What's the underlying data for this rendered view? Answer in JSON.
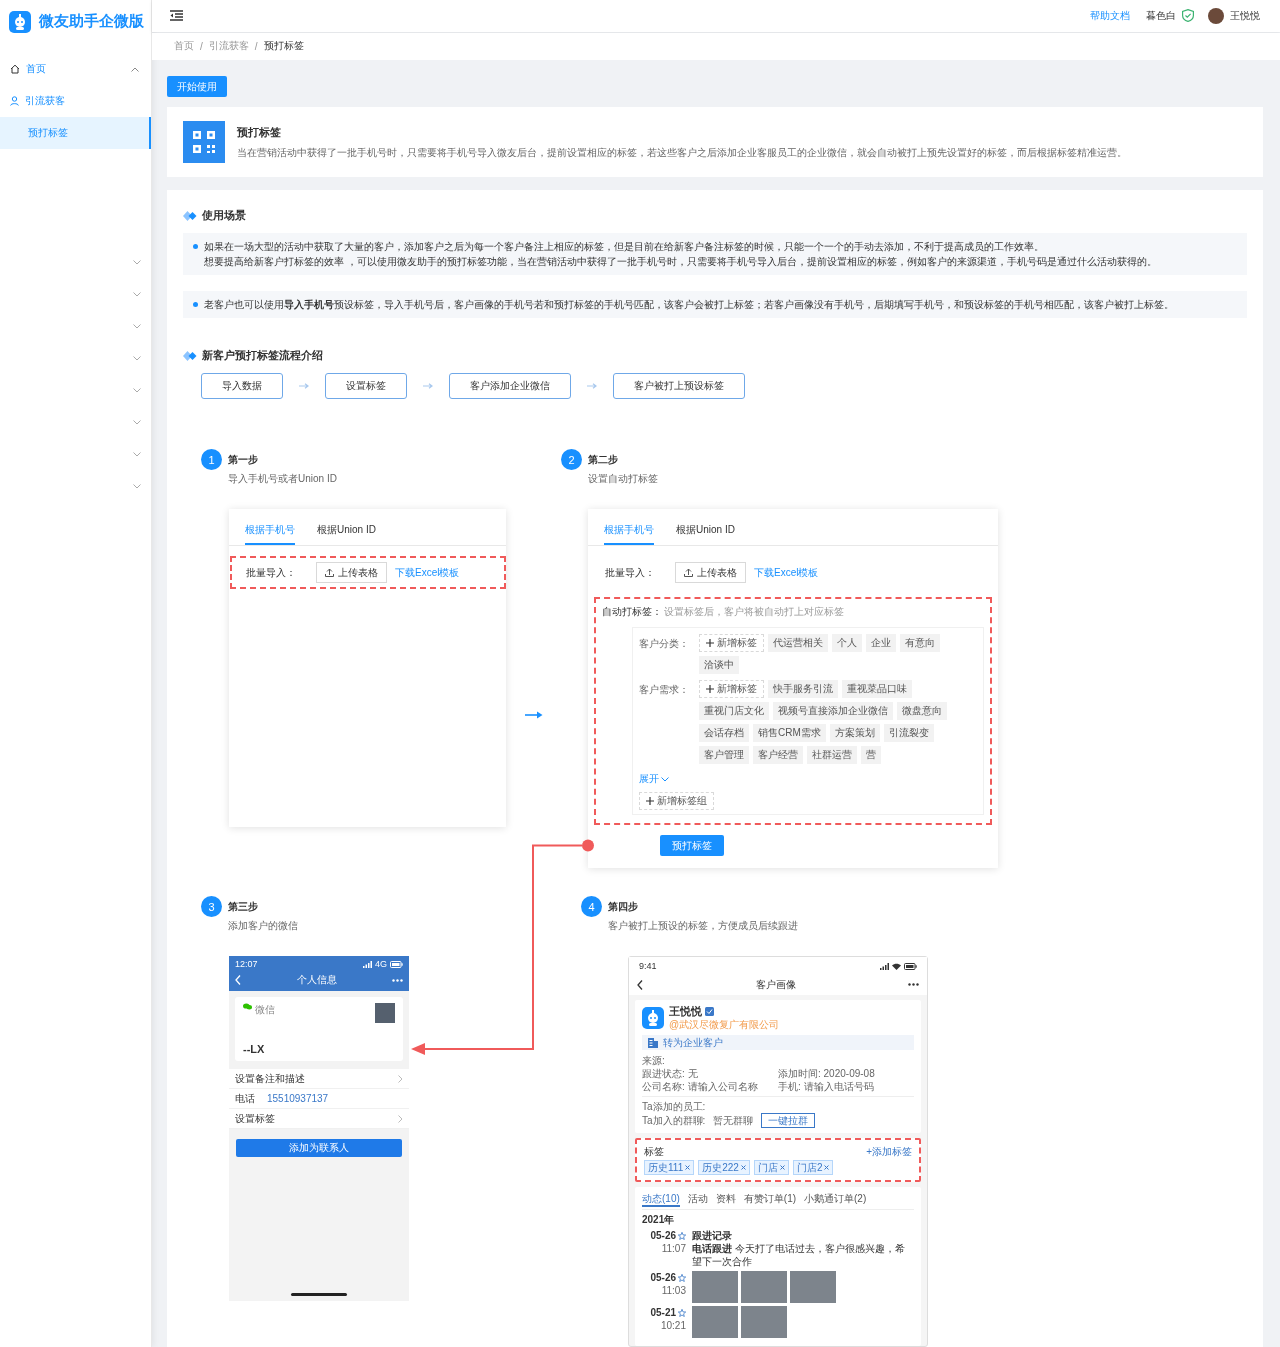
{
  "sidebar": {
    "brand": "微友助手企微版",
    "menu": [
      {
        "label": "首页",
        "expanded": true,
        "children": [
          {
            "label": "引流获客",
            "selected": false,
            "children": [
              {
                "label": "预打标签",
                "selected": true
              }
            ]
          }
        ]
      }
    ],
    "menu_groups": [
      {
        "expanded": false
      },
      {
        "expanded": false
      },
      {
        "expanded": false
      },
      {
        "expanded": false
      },
      {
        "expanded": false
      },
      {
        "expanded": false
      },
      {
        "expanded": false
      },
      {
        "expanded": false
      }
    ]
  },
  "header": {
    "help_link": "帮助文档",
    "theme": "暮色白",
    "user": "王悦悦"
  },
  "breadcrumb": {
    "separator": "/",
    "items": [
      "首页",
      "引流获客",
      "预打标签"
    ]
  },
  "start_button": "开始使用",
  "intro": {
    "title": "预打标签",
    "description": "当在营销活动中获得了一批手机号时，只需要将手机号导入微友后台，提前设置相应的标签，若这些客户之后添加企业客服员工的企业微信，就会自动被打上预先设置好的标签，而后根据标签精准运营。"
  },
  "scenarios": {
    "title": "使用场景",
    "notes": [
      {
        "lines": [
          "如果在一场大型的活动中获取了大量的客户，添加客户之后为每一个客户备注上相应的标签，但是目前在给新客户备注标签的时候，只能一个一个的手动去添加，不利于提高成员的工作效率。",
          "想要提高给新客户打标签的效率 ，可以使用微友助手的预打标签功能，当在营销活动中获得了一批手机号时，只需要将手机号导入后台，提前设置相应的标签，例如客户的来源渠道，手机号码是通过什么活动获得的。"
        ]
      },
      {
        "lines": [
          "老客户也可以使用**导入手机号**预设标签，导入手机号后，客户画像的手机号若和预打标签的手机号匹配，该客户会被打上标签；若客户画像没有手机号，后期填写手机号，和预设标签的手机号相匹配，该客户被打上标签。"
        ]
      }
    ]
  },
  "flow": {
    "title": "新客户预打标签流程介绍",
    "steps": [
      "导入数据",
      "设置标签",
      "客户添加企业微信",
      "客户被打上预设标签"
    ]
  },
  "steps": [
    {
      "number": "1",
      "title": "第一步",
      "subtitle": "导入手机号或者Union ID",
      "mock": {
        "kind": "import",
        "tabs": [
          {
            "label": "根据手机号",
            "selected": true
          },
          {
            "label": "根据Union ID",
            "selected": false
          }
        ],
        "import": {
          "label": "批量导入：",
          "button": "上传表格",
          "link": "下载Excel模板",
          "highlighted": true
        }
      }
    },
    {
      "number": "2",
      "title": "第二步",
      "subtitle": "设置自动打标签",
      "mock": {
        "kind": "auto-tag",
        "tabs": [
          {
            "label": "根据手机号",
            "selected": true
          },
          {
            "label": "根据Union ID",
            "selected": false
          }
        ],
        "import": {
          "label": "批量导入：",
          "button": "上传表格",
          "link": "下载Excel模板",
          "highlighted": false
        },
        "auto_tag": {
          "label": "自动打标签：",
          "hint": "设置标签后，客户将被自动打上对应标签",
          "highlighted": true,
          "groups": [
            {
              "name": "客户分类：",
              "add": "新增标签",
              "tags": [
                "代运营相关",
                "个人",
                "企业",
                "有意向",
                "洽谈中"
              ]
            },
            {
              "name": "客户需求：",
              "add": "新增标签",
              "tags": [
                "快手服务引流",
                "重视菜品口味",
                "重视门店文化",
                "视频号直接添加企业微信",
                "微盘意向",
                "会话存档",
                "销售CRM需求",
                "方案策划",
                "引流裂变",
                "客户管理",
                "客户经营",
                "社群运营",
                "营"
              ]
            }
          ],
          "expand": "展开",
          "add_group": "新增标签组"
        },
        "submit": "预打标签"
      }
    },
    {
      "number": "3",
      "title": "第三步",
      "subtitle": "添加客户的微信",
      "mock": {
        "kind": "wechat-profile",
        "time": "12:07",
        "network": "4G",
        "title": "个人信息",
        "source": "微信",
        "name": "--LX",
        "rows": [
          {
            "label": "设置备注和描述"
          },
          {
            "label": "电话",
            "value": "15510937137"
          },
          {
            "label": "设置标签"
          }
        ],
        "button": "添加为联系人"
      }
    },
    {
      "number": "4",
      "title": "第四步",
      "subtitle": "客户被打上预设的标签，方便成员后续跟进",
      "mock": {
        "kind": "customer-profile",
        "time": "9:41",
        "title": "客户画像",
        "name": "王悦悦",
        "company": "@武汉尽微复广有限公司",
        "convert": "转为企业客户",
        "info_rows": [
          [
            "来源:"
          ],
          [
            "跟进状态: 无",
            "添加时间: 2020-09-08"
          ],
          [
            "公司名称: 请输入公司名称",
            "手机: 请输入电话号码"
          ]
        ],
        "staff_label": "Ta添加的员工:",
        "groups_label": "Ta加入的群聊:",
        "groups_value": "暂无群聊",
        "pull_button": "一键拉群",
        "tags": {
          "title": "标签",
          "add": "+添加标签",
          "highlighted": true,
          "items": [
            "历史111",
            "历史222",
            "门店",
            "门店2"
          ]
        },
        "tabs": [
          {
            "label": "动态(10)",
            "selected": true
          },
          {
            "label": "活动",
            "selected": false
          },
          {
            "label": "资料",
            "selected": false
          },
          {
            "label": "有赞订单(1)",
            "selected": false
          },
          {
            "label": "小鹅通订单(2)",
            "selected": false
          }
        ],
        "year": "2021年",
        "timeline": [
          {
            "date": "05-26",
            "time": "11:07",
            "kind": "note",
            "title": "跟进记录",
            "text": "**电话跟进** 今天打了电话过去，客户很感兴趣，希望下一次合作"
          },
          {
            "date": "05-26",
            "time": "11:03",
            "kind": "photos",
            "photos": [
              {
                "kind": "photo"
              },
              {
                "kind": "photo"
              },
              {
                "kind": "photo"
              }
            ]
          },
          {
            "date": "05-21",
            "time": "10:21",
            "kind": "photos",
            "photos": [
              {
                "kind": "photo"
              },
              {
                "kind": "photo"
              }
            ]
          }
        ]
      }
    }
  ]
}
